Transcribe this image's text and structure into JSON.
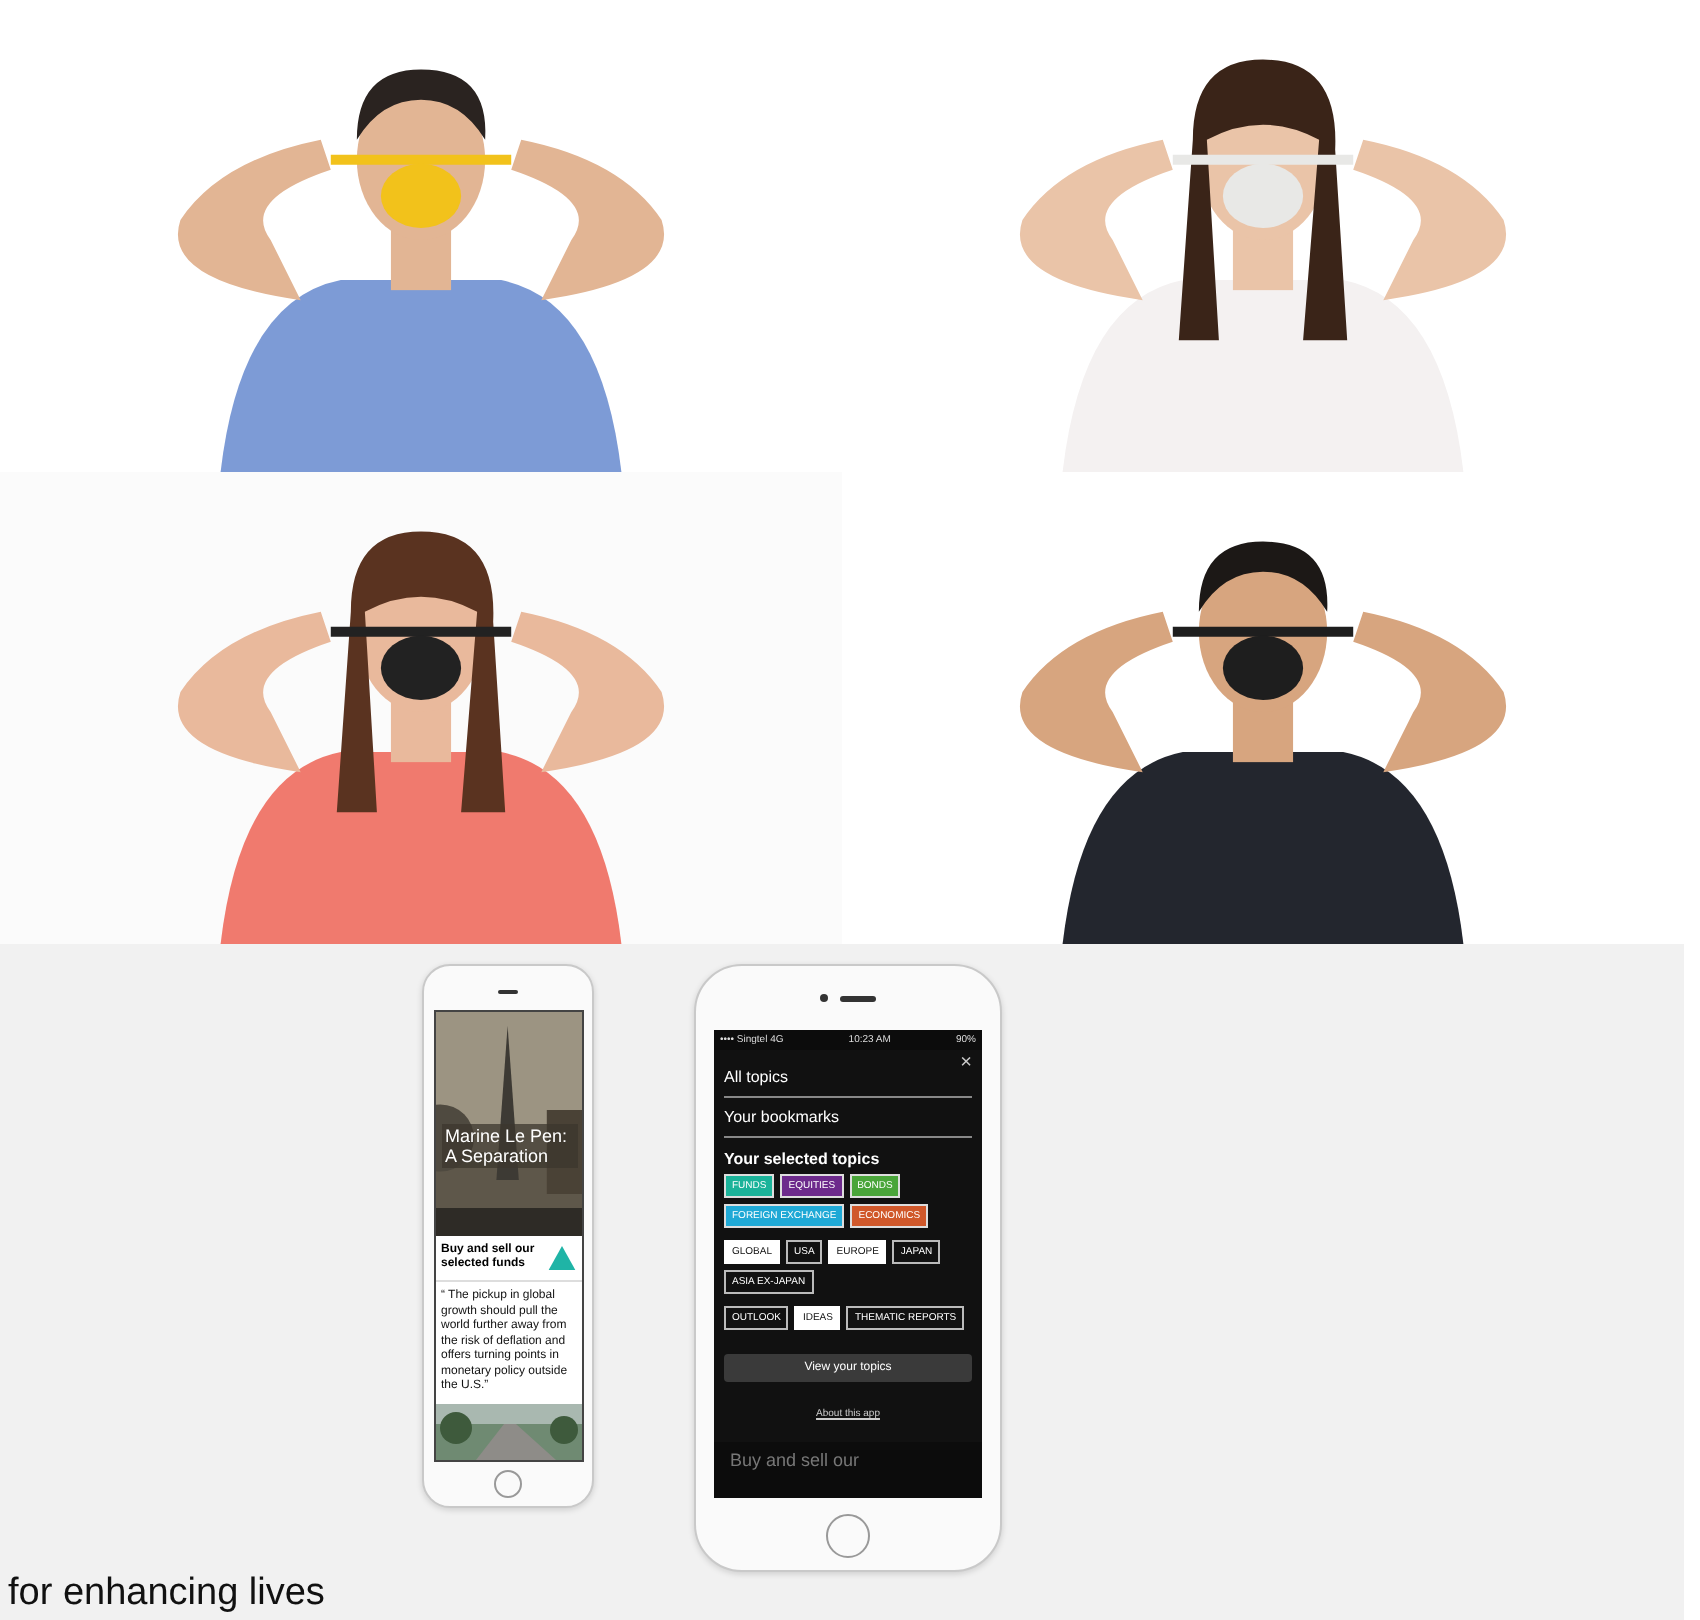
{
  "phone_left": {
    "article_title": "Marine Le Pen: A Separation",
    "promo_title": "Buy and sell our selected funds",
    "quote": "“ The pickup in global growth should pull the world further away from the risk of deflation and offers turning points in monetary policy outside the U.S.”"
  },
  "phone_right": {
    "status": {
      "carrier": "•••• Singtel 4G",
      "time": "10:23 AM",
      "battery": "90%"
    },
    "close": "×",
    "menu": [
      "All topics",
      "Your bookmarks"
    ],
    "section_title": "Your selected topics",
    "topic_groups": [
      [
        {
          "label": "FUNDS",
          "color": "#1bb39a"
        },
        {
          "label": "EQUITIES",
          "color": "#6d2a8c"
        },
        {
          "label": "BONDS",
          "color": "#4aa53a"
        },
        {
          "label": "FOREIGN EXCHANGE",
          "color": "#1fa9d6"
        },
        {
          "label": "ECONOMICS",
          "color": "#d0582a"
        }
      ],
      [
        {
          "label": "GLOBAL",
          "selected": true
        },
        {
          "label": "USA",
          "selected": false
        },
        {
          "label": "EUROPE",
          "selected": true
        },
        {
          "label": "JAPAN",
          "selected": false
        },
        {
          "label": "ASIA EX-JAPAN",
          "selected": false
        }
      ],
      [
        {
          "label": "OUTLOOK",
          "selected": false
        },
        {
          "label": "IDEAS",
          "selected": true
        },
        {
          "label": "THEMATIC REPORTS",
          "selected": false
        }
      ]
    ],
    "button": "View your topics",
    "link": "About this app",
    "peek_text": "Buy and sell our"
  },
  "tagline": "for enhancing lives"
}
